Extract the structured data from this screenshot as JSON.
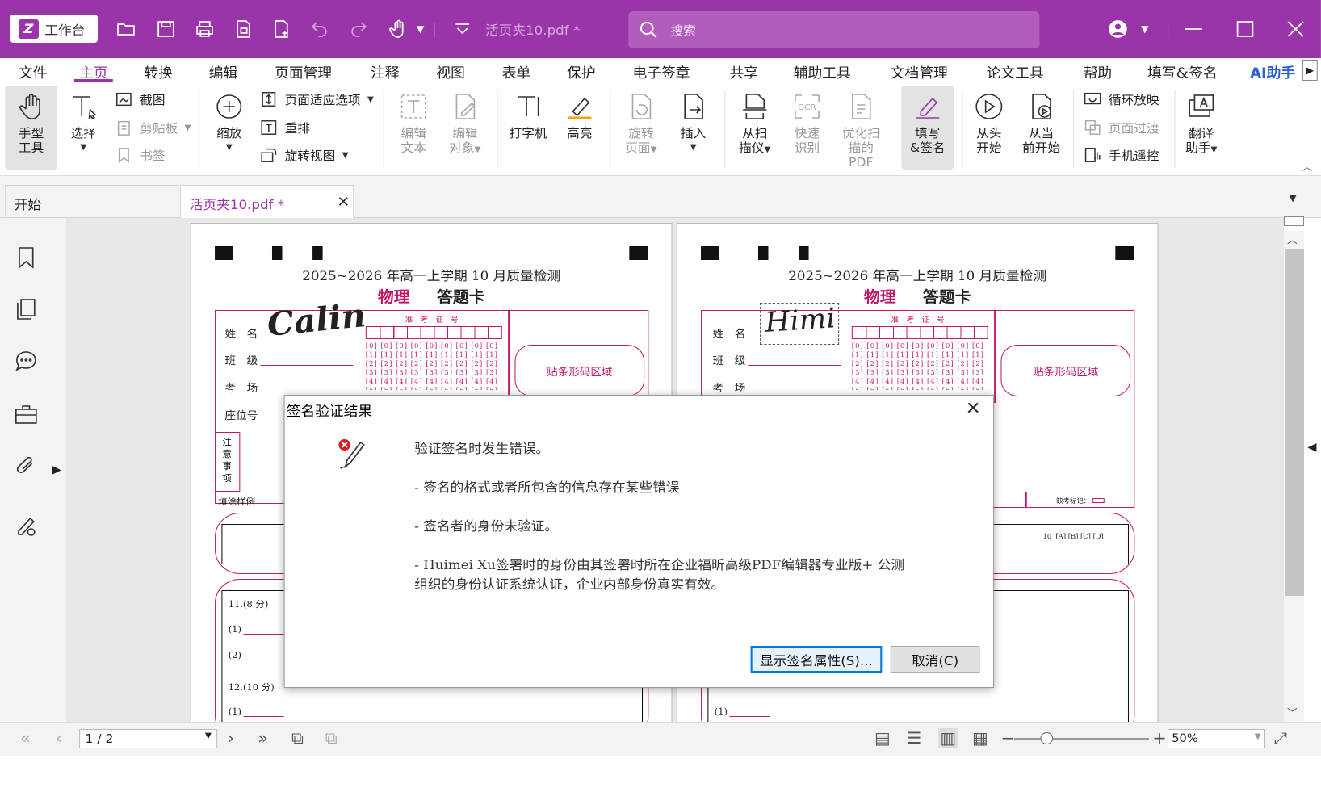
{
  "titlebar": {
    "workbench_label": "工作台",
    "doc_name": "活页夹10.pdf *",
    "search_placeholder": "搜索"
  },
  "menu": [
    "文件",
    "主页",
    "转换",
    "编辑",
    "页面管理",
    "注释",
    "视图",
    "表单",
    "保护",
    "电子签章",
    "共享",
    "辅助工具",
    "文档管理",
    "论文工具",
    "帮助",
    "填写&签名",
    "AI助手"
  ],
  "ribbon": {
    "hand_tool": [
      "手型",
      "工具"
    ],
    "select": "选择",
    "screenshot": "截图",
    "clipboard": "剪贴板",
    "bookmark": "书签",
    "zoom": "缩放",
    "page_fit": "页面适应选项",
    "reflow": "重排",
    "rotate_view": "旋转视图",
    "edit_text": [
      "编辑",
      "文本"
    ],
    "edit_object": [
      "编辑",
      "对象"
    ],
    "typewriter": "打字机",
    "highlight": "高亮",
    "rotate_page": [
      "旋转",
      "页面"
    ],
    "insert": "插入",
    "scanner": [
      "从扫",
      "描仪"
    ],
    "quick_ocr": [
      "快速",
      "识别"
    ],
    "optimize_scan": [
      "优化扫",
      "描的PDF"
    ],
    "fill_sign": [
      "填写",
      "&签名"
    ],
    "from_start": [
      "从头",
      "开始"
    ],
    "from_current": [
      "从当",
      "前开始"
    ],
    "loop_play": "循环放映",
    "page_transition": "页面过渡",
    "phone_remote": "手机遥控",
    "translate": [
      "翻译",
      "助手"
    ]
  },
  "tabs": {
    "start": "开始",
    "doc": "活页夹10.pdf *"
  },
  "pages": {
    "header": "2025~2026 年高一上学期 10 月质量检测",
    "subject": "物理",
    "card": "答题卡",
    "name_label": "姓　名",
    "class_label": "班　级",
    "room_label": "考　场",
    "seat_label": "座位号",
    "exam_id_label": "准　考　证　号",
    "barcode_label": "贴条形码区域",
    "notes_label": "注意事项",
    "fill_sample": "填涂样例",
    "sig_left": "Calin",
    "sig_right": "Himi",
    "q11": "11.(8 分)",
    "q12": "12.(10 分)",
    "sub1": "(1)",
    "sub2": "(2)",
    "missing_mark": "缺考标记：",
    "q_row10": "10"
  },
  "statusbar": {
    "page": "1 / 2",
    "zoom": "50%"
  },
  "dialog": {
    "title": "签名验证结果",
    "line1": "验证签名时发生错误。",
    "line2": "- 签名的格式或者所包含的信息存在某些错误",
    "line3": "- 签名者的身份未验证。",
    "line4": "- Huimei Xu签署时的身份由其签署时所在企业福昕高级PDF编辑器专业版+ 公测",
    "line5": "组织的身份认证系统认证，企业内部身份真实有效。",
    "btn_props": "显示签名属性(S)...",
    "btn_cancel": "取消(C)"
  },
  "colors": {
    "accent": "#9a35a9",
    "magenta": "#c2186b"
  }
}
